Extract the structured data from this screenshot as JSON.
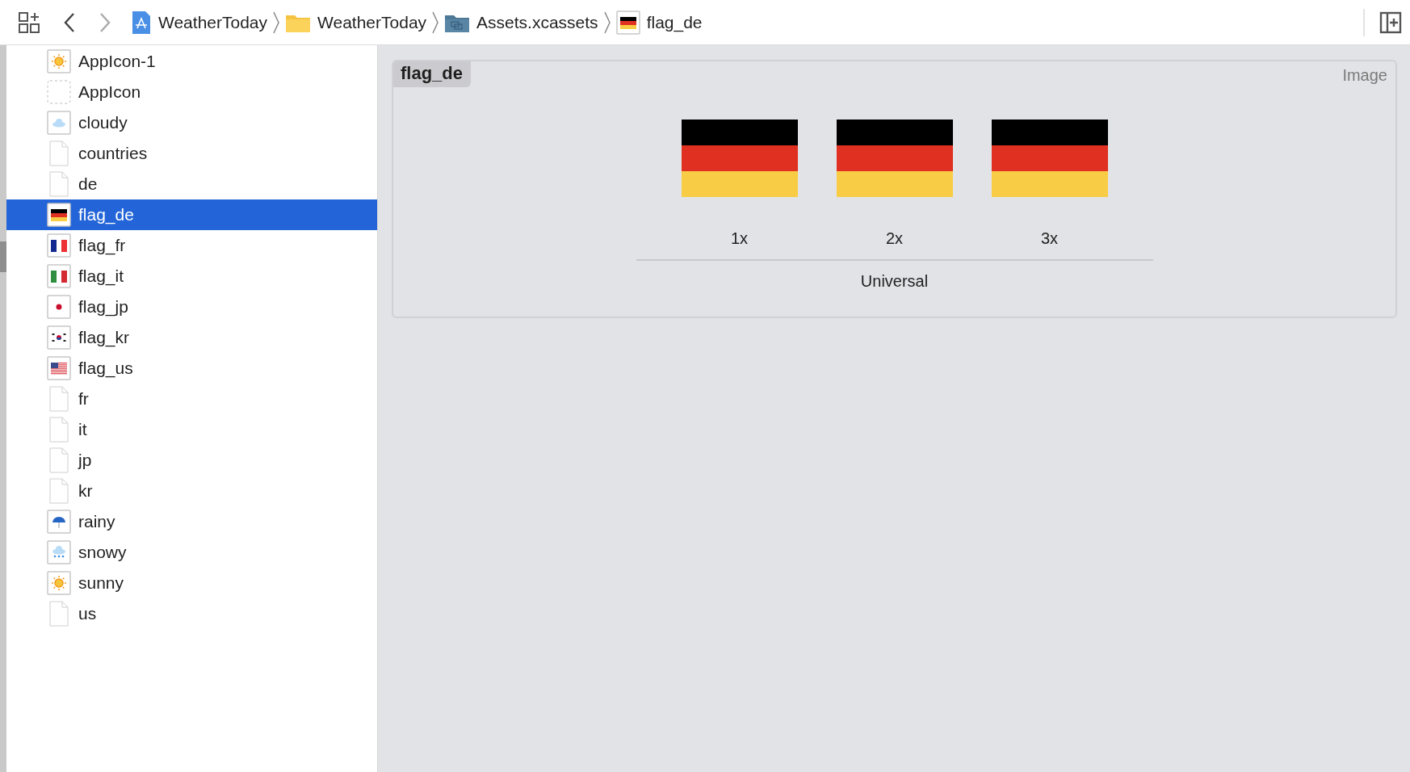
{
  "breadcrumbs": [
    {
      "label": "WeatherToday",
      "kind": "project"
    },
    {
      "label": "WeatherToday",
      "kind": "folder"
    },
    {
      "label": "Assets.xcassets",
      "kind": "assets"
    },
    {
      "label": "flag_de",
      "kind": "flag-de"
    }
  ],
  "sidebar": {
    "items": [
      {
        "label": "AppIcon-1",
        "kind": "sun",
        "selected": false
      },
      {
        "label": "AppIcon",
        "kind": "dashed",
        "selected": false
      },
      {
        "label": "cloudy",
        "kind": "cloud",
        "selected": false
      },
      {
        "label": "countries",
        "kind": "file",
        "selected": false
      },
      {
        "label": "de",
        "kind": "file",
        "selected": false
      },
      {
        "label": "flag_de",
        "kind": "flag-de",
        "selected": true
      },
      {
        "label": "flag_fr",
        "kind": "flag-fr",
        "selected": false
      },
      {
        "label": "flag_it",
        "kind": "flag-it",
        "selected": false
      },
      {
        "label": "flag_jp",
        "kind": "flag-jp",
        "selected": false
      },
      {
        "label": "flag_kr",
        "kind": "flag-kr",
        "selected": false
      },
      {
        "label": "flag_us",
        "kind": "flag-us",
        "selected": false
      },
      {
        "label": "fr",
        "kind": "file",
        "selected": false
      },
      {
        "label": "it",
        "kind": "file",
        "selected": false
      },
      {
        "label": "jp",
        "kind": "file",
        "selected": false
      },
      {
        "label": "kr",
        "kind": "file",
        "selected": false
      },
      {
        "label": "rainy",
        "kind": "umbrella",
        "selected": false
      },
      {
        "label": "snowy",
        "kind": "snow",
        "selected": false
      },
      {
        "label": "sunny",
        "kind": "sun",
        "selected": false
      },
      {
        "label": "us",
        "kind": "file",
        "selected": false
      }
    ]
  },
  "image_set": {
    "name": "flag_de",
    "type": "Image",
    "slots": [
      {
        "label": "1x"
      },
      {
        "label": "2x"
      },
      {
        "label": "3x"
      }
    ],
    "group": "Universal"
  }
}
